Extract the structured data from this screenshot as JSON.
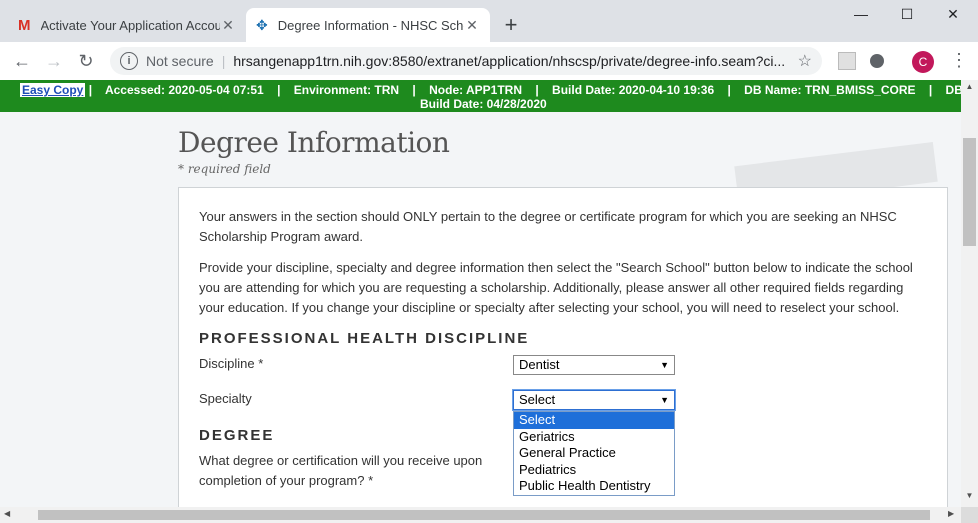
{
  "browser": {
    "tabs": [
      {
        "title": "Activate Your Application Accou",
        "icon": "gmail-icon"
      },
      {
        "title": "Degree Information - NHSC Scho",
        "icon": "nhsc-icon"
      }
    ],
    "address": {
      "security": "Not secure",
      "url": "hrsangenapp1trn.nih.gov:8580/extranet/application/nhscsp/private/degree-info.seam?ci..."
    },
    "avatar_letter": "C"
  },
  "env_bar": {
    "easy_copy": "Easy Copy",
    "line1": "|    Accessed: 2020-05-04 07:51    |    Environment: TRN    |    Node: APP1TRN    |    Build Date: 2020-04-10 19:36    |    DB Name: TRN_BMISS_CORE    |    DB",
    "line2": "Build Date: 04/28/2020"
  },
  "page": {
    "title": "Degree Information",
    "required_note": "* required field",
    "intro1": "Your answers in the section should ONLY pertain to the degree or certificate program for which you are seeking an NHSC Scholarship Program award.",
    "intro2": "Provide your discipline, specialty and degree information then select the \"Search School\" button below to indicate the school you are attending for which you are requesting a scholarship. Additionally, please answer all other required fields regarding your education. If you change your discipline or specialty after selecting your school, you will need to reselect your school.",
    "section_discipline": "PROFESSIONAL HEALTH DISCIPLINE",
    "discipline_label": "Discipline *",
    "discipline_value": "Dentist",
    "specialty_label": "Specialty",
    "specialty_value": "Select",
    "specialty_options": [
      "Select",
      "Geriatrics",
      "General Practice",
      "Pediatrics",
      "Public Health Dentistry"
    ],
    "section_degree": "DEGREE",
    "degree_question": "What degree or certification will you receive upon completion of your program? *"
  }
}
